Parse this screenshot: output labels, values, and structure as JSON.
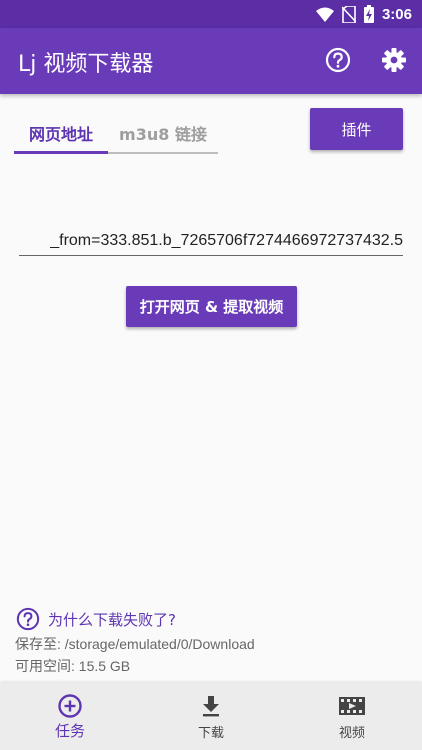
{
  "status_bar": {
    "time": "3:06"
  },
  "app_bar": {
    "title": "Lj 视频下载器",
    "icons": [
      "help-icon",
      "gear-icon"
    ]
  },
  "tabs": [
    {
      "label": "网页地址",
      "active": true
    },
    {
      "label": "m3u8 链接",
      "active": false
    }
  ],
  "plugin_button": "插件",
  "url_input": {
    "value": "_from=333.851.b_7265706f7274466972737432.5"
  },
  "open_button": "打开网页 & 提取视频",
  "fail_link": "为什么下载失败了?",
  "save_path": "保存至: /storage/emulated/0/Download",
  "free_space": "可用空间: 15.5 GB",
  "bottom_nav": [
    {
      "label": "任务",
      "icon": "add-circle-icon",
      "active": true
    },
    {
      "label": "下载",
      "icon": "download-icon",
      "active": false
    },
    {
      "label": "视频",
      "icon": "video-icon",
      "active": false
    }
  ],
  "colors": {
    "primary": "#6a3bb8",
    "status_bar": "#5b2ea6",
    "accent_text": "#5e35b1"
  }
}
